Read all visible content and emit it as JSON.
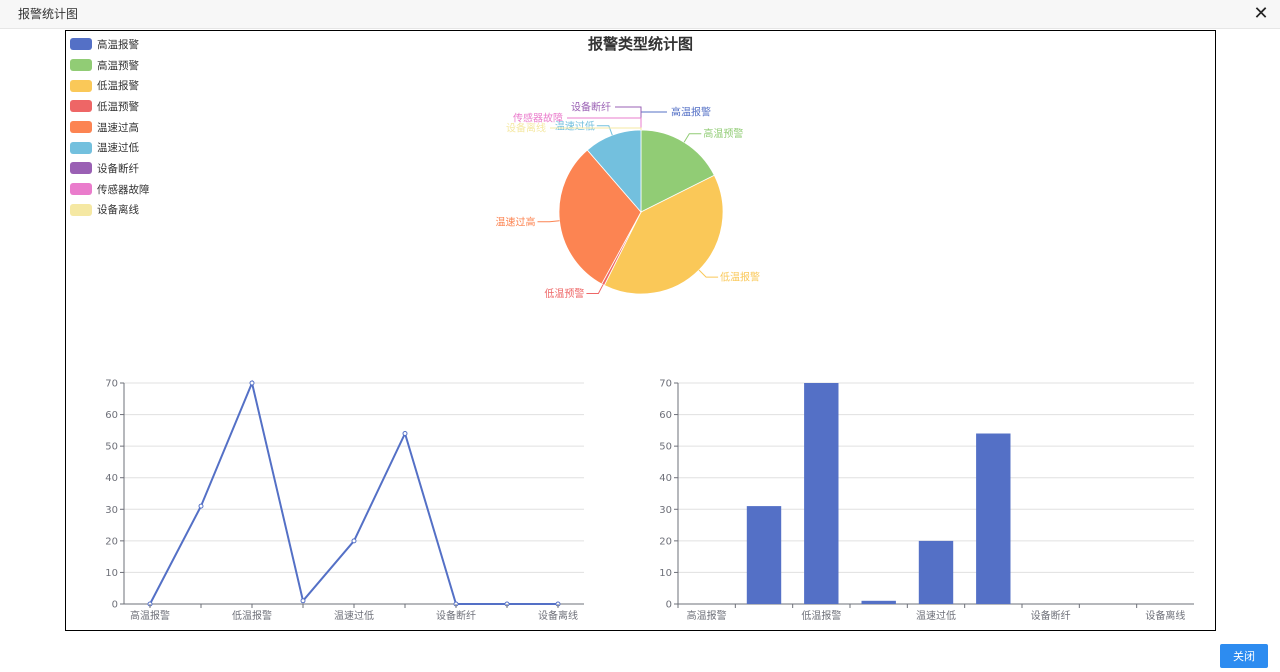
{
  "dialog": {
    "title": "报警统计图",
    "close_button_label": "关闭"
  },
  "colors": {
    "line": "#5470c6",
    "bar": "#5470c6",
    "grid": "#e0e0e0",
    "axis": "#6e7079",
    "button": "#2d8cf0"
  },
  "chart_data": [
    {
      "type": "pie",
      "title": "报警类型统计图",
      "legend_position": "top-left",
      "slices": [
        {
          "name": "高温报警",
          "value": 0,
          "color": "#5470c6"
        },
        {
          "name": "高温预警",
          "value": 31,
          "color": "#91cc75"
        },
        {
          "name": "低温报警",
          "value": 70,
          "color": "#fac858"
        },
        {
          "name": "低温预警",
          "value": 1,
          "color": "#ee6666"
        },
        {
          "name": "温速过高",
          "value": 54,
          "color": "#fc8452"
        },
        {
          "name": "温速过低",
          "value": 20,
          "color": "#73c0de"
        },
        {
          "name": "设备断纤",
          "value": 0,
          "color": "#9a60b4"
        },
        {
          "name": "传感器故障",
          "value": 0,
          "color": "#ea7ccc"
        },
        {
          "name": "设备离线",
          "value": 0,
          "color": "#f5e8a3"
        }
      ]
    },
    {
      "type": "line",
      "categories": [
        "高温报警",
        "高温预警",
        "低温报警",
        "低温预警",
        "温速过低",
        "温速过高",
        "设备断纤",
        "传感器故障",
        "设备离线"
      ],
      "category_labels_shown": [
        "高温报警",
        "低温报警",
        "温速过低",
        "设备断纤",
        "设备离线"
      ],
      "values": [
        0,
        31,
        70,
        1,
        20,
        54,
        0,
        0,
        0
      ],
      "ylim": [
        0,
        70
      ],
      "yticks": [
        0,
        10,
        20,
        30,
        40,
        50,
        60,
        70
      ],
      "grid": true
    },
    {
      "type": "bar",
      "categories": [
        "高温报警",
        "高温预警",
        "低温报警",
        "低温预警",
        "温速过低",
        "温速过高",
        "设备断纤",
        "传感器故障",
        "设备离线"
      ],
      "category_labels_shown": [
        "高温报警",
        "低温报警",
        "温速过低",
        "设备断纤",
        "设备离线"
      ],
      "values": [
        0,
        31,
        70,
        1,
        20,
        54,
        0,
        0,
        0
      ],
      "ylim": [
        0,
        70
      ],
      "yticks": [
        0,
        10,
        20,
        30,
        40,
        50,
        60,
        70
      ],
      "grid": true
    }
  ]
}
